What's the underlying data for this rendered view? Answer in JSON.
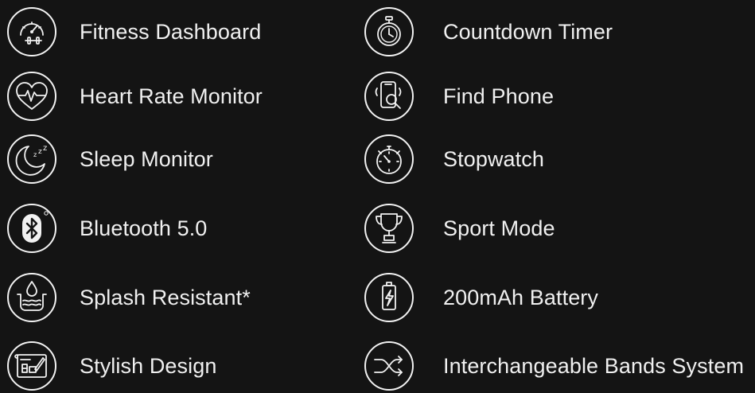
{
  "features": [
    {
      "label": "Fitness Dashboard",
      "icon": "fitness-dashboard-icon"
    },
    {
      "label": "Heart Rate Monitor",
      "icon": "heart-rate-icon"
    },
    {
      "label": "Sleep Monitor",
      "icon": "sleep-moon-icon"
    },
    {
      "label": "Bluetooth 5.0",
      "icon": "bluetooth-icon"
    },
    {
      "label": "Splash Resistant*",
      "icon": "water-drop-icon"
    },
    {
      "label": "Stylish Design",
      "icon": "design-blueprint-icon"
    },
    {
      "label": "Countdown Timer",
      "icon": "countdown-timer-icon"
    },
    {
      "label": "Find Phone",
      "icon": "find-phone-icon"
    },
    {
      "label": "Stopwatch",
      "icon": "stopwatch-icon"
    },
    {
      "label": "Sport Mode",
      "icon": "trophy-icon"
    },
    {
      "label": "200mAh Battery",
      "icon": "battery-icon"
    },
    {
      "label": "Interchangeable Bands System",
      "icon": "shuffle-arrows-icon"
    }
  ],
  "colors": {
    "background": "#141414",
    "foreground": "#f2f2f2"
  }
}
